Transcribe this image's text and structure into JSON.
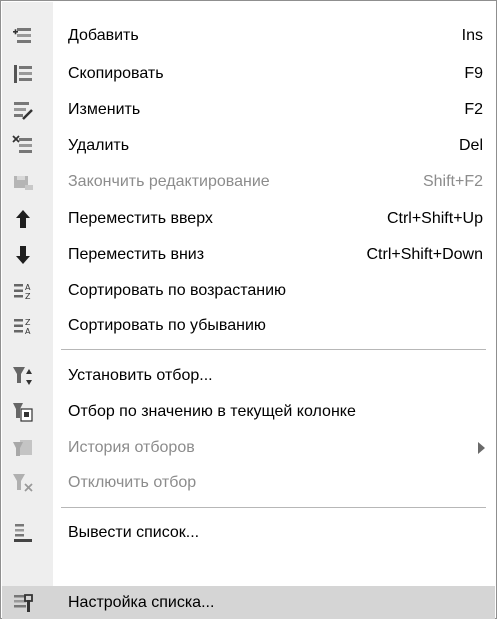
{
  "menu": {
    "items": [
      {
        "label": "Добавить",
        "shortcut": "Ins",
        "icon": "add-row-icon"
      },
      {
        "label": "Скопировать",
        "shortcut": "F9",
        "icon": "copy-row-icon"
      },
      {
        "label": "Изменить",
        "shortcut": "F2",
        "icon": "edit-row-icon"
      },
      {
        "label": "Удалить",
        "shortcut": "Del",
        "icon": "delete-row-icon"
      },
      {
        "label": "Закончить редактирование",
        "shortcut": "Shift+F2",
        "icon": "finish-edit-icon",
        "disabled": true
      },
      {
        "label": "Переместить вверх",
        "shortcut": "Ctrl+Shift+Up",
        "icon": "move-up-icon"
      },
      {
        "label": "Переместить вниз",
        "shortcut": "Ctrl+Shift+Down",
        "icon": "move-down-icon"
      },
      {
        "label": "Сортировать по возрастанию",
        "shortcut": "",
        "icon": "sort-ascending-icon"
      },
      {
        "label": "Сортировать по убыванию",
        "shortcut": "",
        "icon": "sort-descending-icon"
      },
      {
        "label": "Установить отбор...",
        "shortcut": "",
        "icon": "set-filter-icon"
      },
      {
        "label": "Отбор по значению в текущей колонке",
        "shortcut": "",
        "icon": "filter-by-value-icon"
      },
      {
        "label": "История отборов",
        "shortcut": "",
        "icon": "filter-history-icon",
        "disabled": true,
        "submenu": true
      },
      {
        "label": "Отключить отбор",
        "shortcut": "",
        "icon": "disable-filter-icon",
        "disabled": true
      },
      {
        "label": "Вывести список...",
        "shortcut": "",
        "icon": "output-list-icon"
      },
      {
        "label": "Настройка списка...",
        "shortcut": "",
        "icon": "list-settings-icon",
        "highlighted": true
      }
    ]
  },
  "colors": {
    "gutter": "#eeeeee",
    "highlight": "#d5d5d5",
    "disabled_text": "#8c8c8c",
    "border": "#8f8f8f"
  }
}
